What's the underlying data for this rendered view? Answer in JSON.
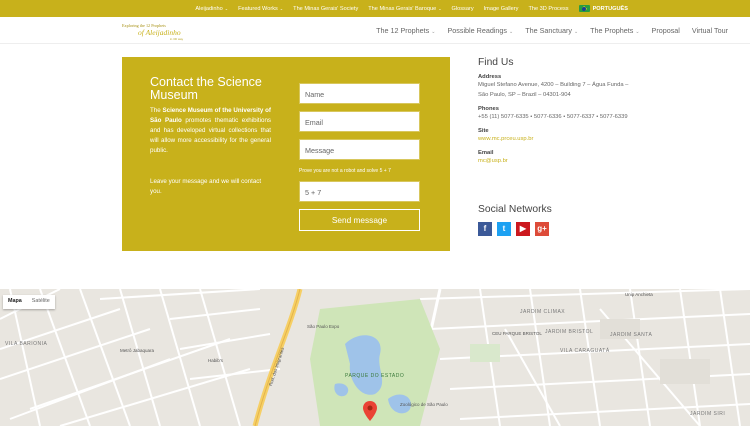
{
  "topbar": {
    "items": [
      {
        "label": "Aleijadinho",
        "caret": true
      },
      {
        "label": "Featured Works",
        "caret": true
      },
      {
        "label": "The Minas Gerais' Society",
        "caret": false
      },
      {
        "label": "The Minas Gerais' Baroque",
        "caret": true
      },
      {
        "label": "Glossary",
        "caret": false
      },
      {
        "label": "Image Gallery",
        "caret": false
      },
      {
        "label": "The 3D Process",
        "caret": false
      }
    ],
    "language": "PORTUGUÊS"
  },
  "logo": {
    "line1": "Exploring the 12 Prophets",
    "line2": "of Aleijadinho",
    "line3": "in 3D way"
  },
  "mainnav": {
    "items": [
      {
        "label": "The 12 Prophets",
        "caret": true
      },
      {
        "label": "Possible Readings",
        "caret": true
      },
      {
        "label": "The Sanctuary",
        "caret": true
      },
      {
        "label": "The Prophets",
        "caret": true
      },
      {
        "label": "Proposal",
        "caret": false
      },
      {
        "label": "Virtual Tour",
        "caret": false
      }
    ]
  },
  "contact": {
    "title": "Contact the Science Museum",
    "desc_pre": "The ",
    "desc_bold": "Science Museum of the University of São Paulo",
    "desc_post": " promotes thematic exhibitions and has developed virtual collections that will allow more accessibility for the general public.",
    "leave": "Leave your message and we will contact you.",
    "name_placeholder": "Name",
    "email_placeholder": "Email",
    "message_placeholder": "Message",
    "captcha_label": "Prove you are not a robot and solve 5 + 7",
    "captcha_value": "5 + 7",
    "send_label": "Send message",
    "bg_color": "#c8b11b"
  },
  "findus": {
    "title": "Find Us",
    "address_label": "Address",
    "address": "Miguel Stefano Avenue, 4200 – Building 7 – Água Funda – São Paulo, SP – Brazil – 04301-904",
    "phones_label": "Phones",
    "phones": "+55 (11) 5077-6335 • 5077-6336 • 5077-6337 • 5077-6339",
    "site_label": "Site",
    "site": "www.mc.prceu.usp.br",
    "email_label": "Email",
    "email": "mc@usp.br"
  },
  "social": {
    "title": "Social Networks",
    "icons": [
      {
        "name": "facebook-icon",
        "glyph": "f",
        "color": "#3b5998"
      },
      {
        "name": "twitter-icon",
        "glyph": "t",
        "color": "#1da1f2"
      },
      {
        "name": "youtube-icon",
        "glyph": "▶",
        "color": "#cc181e"
      },
      {
        "name": "google-plus-icon",
        "glyph": "g+",
        "color": "#dd4b39"
      }
    ]
  },
  "map": {
    "type_map": "Mapa",
    "type_satellite": "Satélite",
    "labels": {
      "parque_estado": "PARQUE DO ESTADO",
      "jardim_climax": "JARDIM CLIMAX",
      "vila_caraguata": "VILA CARAGUATÁ",
      "ceu_bristol": "CEU PARQUE BRISTOL",
      "jardim_bristol": "JARDIM BRISTOL",
      "vila_barionia": "VILA BARIONIA",
      "metro": "Metrô Jabaquara",
      "zoo": "Zoológico de São Paulo",
      "expo": "São Paulo Expo",
      "habibs": "Habib's",
      "anchieta": "Unip Anchieta",
      "imigrantes": "Rod. dos Imigrantes",
      "jardim_santa": "JARDIM SANTA",
      "jardim_siri": "JARDIM SIRI"
    }
  }
}
